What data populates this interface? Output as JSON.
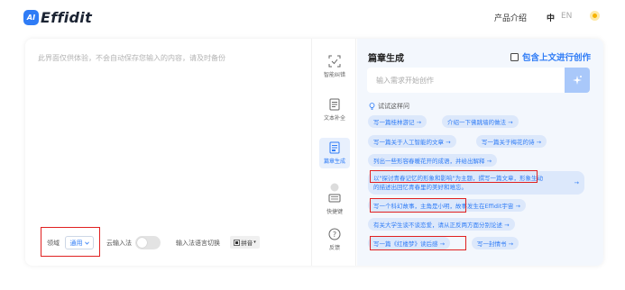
{
  "header": {
    "logo_badge": "AI",
    "logo_text": "Effidit",
    "nav_product": "产品介绍",
    "lang_zh": "中",
    "lang_en": "EN"
  },
  "editor": {
    "placeholder": "此界面仅供体验，不会自动保存您输入的内容，请及时备份",
    "field_label": "领域",
    "field_value": "通用",
    "cloud_label": "云输入法",
    "lang_switch_label": "输入法语言切换",
    "pinyin_label": "拼音"
  },
  "tools": [
    {
      "name": "smart-error-tool",
      "label": "智能纠错"
    },
    {
      "name": "text-complete-tool",
      "label": "文本补全"
    },
    {
      "name": "article-gen-tool",
      "label": "篇章生成"
    },
    {
      "name": "shortcut-tool",
      "label": "快捷键"
    },
    {
      "name": "feedback-tool",
      "label": "反馈"
    }
  ],
  "panel": {
    "title": "篇章生成",
    "context_check": "包含上文进行创作",
    "input_placeholder": "输入需求开始创作",
    "hint": "试试这样问",
    "suggestions": [
      "写一篇桂林游记 →",
      "介绍一下佛跳墙的做法 →",
      "写一篇关于人工智能的文章 →",
      "写一篇关于梅花的诗 →",
      "列出一些形容春暖花开的成语，并给出解释 →",
      "写一个科幻故事，主角是小明，",
      "故事发生在Effidit宇宙 →",
      "有关大学生谈不谈恋爱，请从正反两方面分别论述 →",
      "写一篇《红楼梦》读后感 →",
      "写一封情书 →"
    ],
    "multi_line_1a": "以\"探讨青春记忆的形象和影响\"为主题，撰写一篇文章",
    "multi_line_1b": "，形象生动",
    "multi_line_2": "的描述出回忆青春里的美好和难忘。",
    "multi_arrow": "→"
  },
  "colors": {
    "accent": "#2f7cf6",
    "highlight": "#e02020",
    "panel_bg": "#f3f7fd",
    "chip_bg": "#dce8fb"
  }
}
